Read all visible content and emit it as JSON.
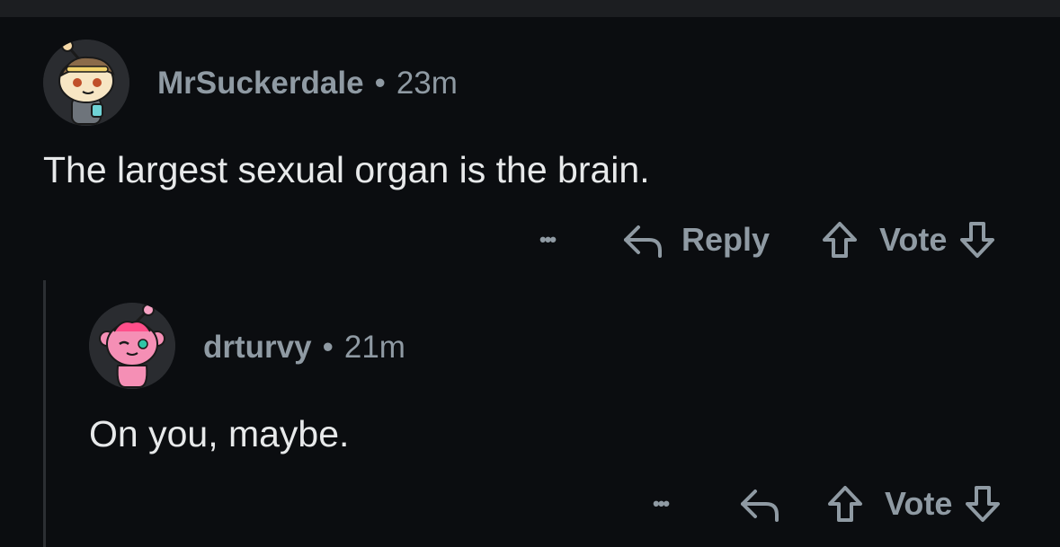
{
  "comments": [
    {
      "username": "MrSuckerdale",
      "separator": "•",
      "time": "23m",
      "text": "The largest sexual organ is the brain.",
      "more_label": "•••",
      "reply_label": "Reply",
      "vote_label": "Vote",
      "avatar_icon": "snoo-avatar-headband"
    },
    {
      "username": "drturvy",
      "separator": "•",
      "time": "21m",
      "text": "On you, maybe.",
      "more_label": "•••",
      "vote_label": "Vote",
      "avatar_icon": "snoo-avatar-pink-brain"
    }
  ],
  "colors": {
    "background": "#0b0d10",
    "meta_text": "#8f9aa3",
    "body_text": "#e7e9ea",
    "thread_line": "#2c2f33"
  }
}
